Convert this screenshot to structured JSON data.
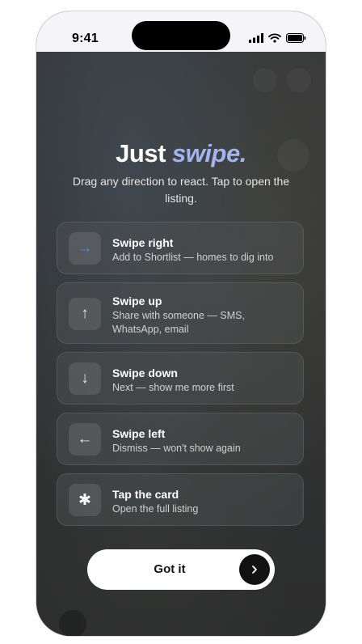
{
  "status_bar": {
    "time": "9:41",
    "icons": [
      "signal-icon",
      "wifi-icon",
      "battery-icon"
    ]
  },
  "onboarding": {
    "title_prefix": "Just",
    "title_accent": "swipe.",
    "subtitle": "Drag any direction to react. Tap to open the listing.",
    "gestures": [
      {
        "icon": "→",
        "icon_name": "arrow-right-icon",
        "title": "Swipe right",
        "description": "Add to Shortlist — homes to dig into"
      },
      {
        "icon": "↑",
        "icon_name": "arrow-up-icon",
        "title": "Swipe up",
        "description": "Share with someone — SMS, WhatsApp, email"
      },
      {
        "icon": "↓",
        "icon_name": "arrow-down-icon",
        "title": "Swipe down",
        "description": "Next — show me more first"
      },
      {
        "icon": "←",
        "icon_name": "arrow-left-icon",
        "title": "Swipe left",
        "description": "Dismiss — won't show again"
      },
      {
        "icon": "✱",
        "icon_name": "asterisk-icon",
        "title": "Tap the card",
        "description": "Open the full listing"
      }
    ],
    "button_label": "Got it",
    "button_icon": "›"
  },
  "colors": {
    "accent": "#a3b4ee",
    "arrow_blue": "#5c7cf2",
    "button_bg": "#ffffff",
    "button_arrow_bg": "#111111"
  }
}
